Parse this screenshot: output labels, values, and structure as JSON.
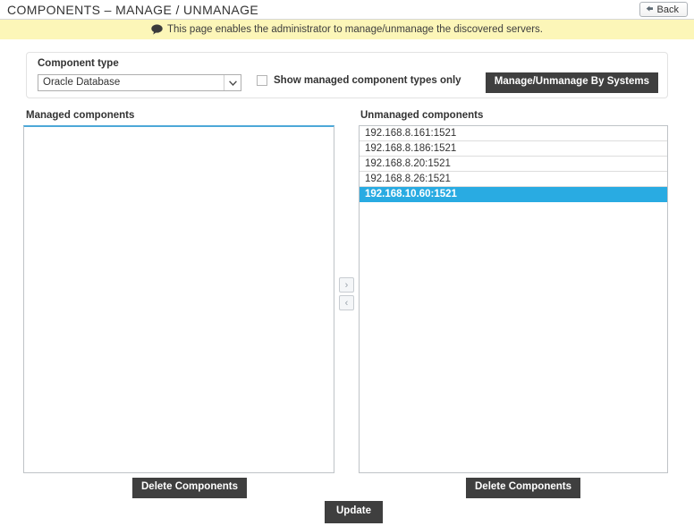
{
  "header": {
    "title": "COMPONENTS – MANAGE / UNMANAGE",
    "back_label": "Back",
    "back_icon": "back-arrow-icon"
  },
  "info_bar": {
    "icon": "speech-bubble-icon",
    "message": "This page enables the administrator to manage/unmanage the discovered servers."
  },
  "form": {
    "component_type_label": "Component type",
    "component_type_value": "Oracle Database",
    "component_type_options": [
      "Oracle Database"
    ],
    "dropdown_icon": "chevron-down-icon",
    "show_managed_label": "Show managed component types only",
    "show_managed_checked": false,
    "manage_by_systems_label": "Manage/Unmanage By Systems"
  },
  "managed_panel": {
    "header": "Managed components",
    "items": [],
    "delete_label": "Delete Components"
  },
  "unmanaged_panel": {
    "header": "Unmanaged components",
    "items": [
      {
        "label": "192.168.8.161:1521",
        "selected": false
      },
      {
        "label": "192.168.8.186:1521",
        "selected": false
      },
      {
        "label": "192.168.8.20:1521",
        "selected": false
      },
      {
        "label": "192.168.8.26:1521",
        "selected": false
      },
      {
        "label": "192.168.10.60:1521",
        "selected": true
      }
    ],
    "delete_label": "Delete Components"
  },
  "transfer": {
    "move_right_icon": "chevron-right-icon",
    "move_right_label": "›",
    "move_left_icon": "chevron-left-icon",
    "move_left_label": "‹"
  },
  "footer": {
    "update_label": "Update"
  },
  "colors": {
    "info_bar_bg": "#fcf6b8",
    "selection_blue": "#29abe2",
    "managed_top_border": "#4da8d8",
    "dark_button_bg": "#3f3f3f"
  }
}
